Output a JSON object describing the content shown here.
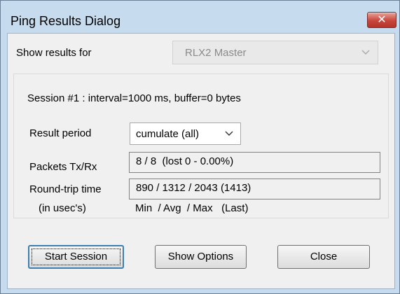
{
  "window": {
    "title": "Ping Results Dialog",
    "close_glyph": "✕",
    "colors": {
      "frame": "#c7dbef",
      "close_button": "#c9463b",
      "default_button_border": "#3c7fb1"
    }
  },
  "show_results": {
    "label": "Show results for",
    "value": "RLX2 Master",
    "disabled": true
  },
  "session": {
    "summary": "Session #1 : interval=1000 ms, buffer=0 bytes",
    "result_period_label": "Result period",
    "result_period_value": "cumulate (all)",
    "packets_label": "Packets Tx/Rx",
    "packets_value": "8 / 8  (lost 0 - 0.00%)",
    "rtt_label": "Round-trip time",
    "rtt_unit_label": "(in usec's)",
    "rtt_value": "890 / 1312 / 2043 (1413)",
    "rtt_legend": "Min  / Avg  / Max   (Last)"
  },
  "buttons": {
    "start": "Start Session",
    "options": "Show Options",
    "close": "Close"
  },
  "icons": {
    "dropdown": "chevron-down-icon",
    "close": "close-icon"
  }
}
